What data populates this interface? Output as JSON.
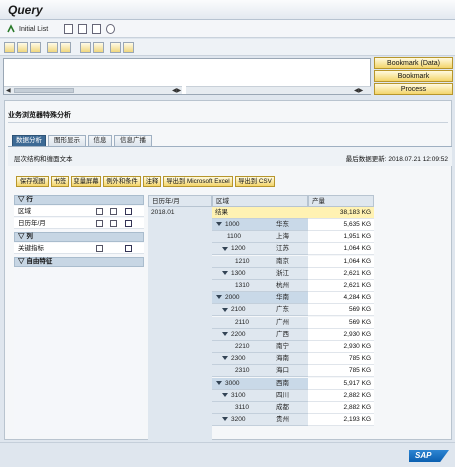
{
  "window": {
    "title": "Query"
  },
  "appbar": {
    "initial_list": "Initial List"
  },
  "bookmark_buttons": [
    "Bookmark (Data)",
    "Bookmark",
    "Process"
  ],
  "page_title": "业务浏览器特殊分析",
  "tabs": [
    "数据分析",
    "图形显示",
    "信息",
    "信息广播"
  ],
  "subheader": {
    "left": "层次结构和缠面文本",
    "right_label": "最后数据更新:",
    "right_value": "2018.07.21 12:09:52"
  },
  "actions": [
    "保存视图",
    "书签",
    "变量屏幕",
    "例外和条件",
    "注释",
    "导出到 Microsoft Excel",
    "导出到 CSV"
  ],
  "nav": {
    "rows_header": "行",
    "rows": [
      "区域",
      "日历年/月"
    ],
    "cols_header": "列",
    "cols": [
      "关键指标"
    ],
    "free_header": "自由特征"
  },
  "table": {
    "col_headers": [
      "日历年/月",
      "区域",
      "产量"
    ],
    "year": "2018.01",
    "total_label": "结果",
    "total_value": "38,183 KG",
    "rows": [
      {
        "code": "1000",
        "name": "华东",
        "value": "5,635 KG",
        "level": 1,
        "expand": true
      },
      {
        "code": "1100",
        "name": "上海",
        "value": "1,951 KG",
        "level": 2,
        "expand": false
      },
      {
        "code": "1200",
        "name": "江苏",
        "value": "1,064 KG",
        "level": 2,
        "expand": true
      },
      {
        "code": "1210",
        "name": "南京",
        "value": "1,064 KG",
        "level": 3,
        "expand": false
      },
      {
        "code": "1300",
        "name": "浙江",
        "value": "2,621 KG",
        "level": 2,
        "expand": true
      },
      {
        "code": "1310",
        "name": "杭州",
        "value": "2,621 KG",
        "level": 3,
        "expand": false
      },
      {
        "code": "2000",
        "name": "华南",
        "value": "4,284 KG",
        "level": 1,
        "expand": true
      },
      {
        "code": "2100",
        "name": "广东",
        "value": "569 KG",
        "level": 2,
        "expand": true
      },
      {
        "code": "2110",
        "name": "广州",
        "value": "569 KG",
        "level": 3,
        "expand": false
      },
      {
        "code": "2200",
        "name": "广西",
        "value": "2,930 KG",
        "level": 2,
        "expand": true
      },
      {
        "code": "2210",
        "name": "南宁",
        "value": "2,930 KG",
        "level": 3,
        "expand": false
      },
      {
        "code": "2300",
        "name": "海南",
        "value": "785 KG",
        "level": 2,
        "expand": true
      },
      {
        "code": "2310",
        "name": "海口",
        "value": "785 KG",
        "level": 3,
        "expand": false
      },
      {
        "code": "3000",
        "name": "西南",
        "value": "5,917 KG",
        "level": 1,
        "expand": true
      },
      {
        "code": "3100",
        "name": "四川",
        "value": "2,882 KG",
        "level": 2,
        "expand": true
      },
      {
        "code": "3110",
        "name": "成都",
        "value": "2,882 KG",
        "level": 3,
        "expand": false
      },
      {
        "code": "3200",
        "name": "贵州",
        "value": "2,193 KG",
        "level": 2,
        "expand": true
      }
    ]
  },
  "brand": "SAP",
  "colors": {
    "accent": "#3d6a95",
    "button": "#f3d56a",
    "total_row": "#fff2b3"
  }
}
